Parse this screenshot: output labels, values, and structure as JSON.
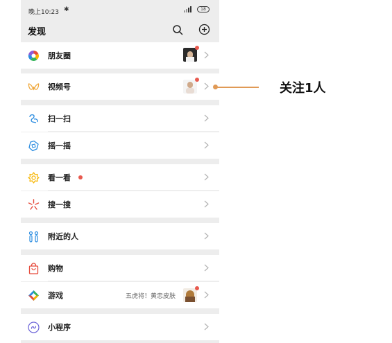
{
  "status_bar": {
    "time": "晚上10:23",
    "bluetooth_glyph": "✱",
    "battery": "18"
  },
  "nav": {
    "title": "发现",
    "search_icon": "search-icon",
    "add_icon": "plus-circle-icon"
  },
  "items": {
    "moments": {
      "label": "朋友圈",
      "icon": "moments-aperture-icon"
    },
    "channels": {
      "label": "视频号",
      "icon": "channels-butterfly-icon"
    },
    "scan": {
      "label": "扫一扫",
      "icon": "scan-icon"
    },
    "shake": {
      "label": "摇一摇",
      "icon": "shake-icon"
    },
    "top_stories": {
      "label": "看一看",
      "icon": "top-stories-icon"
    },
    "search": {
      "label": "搜一搜",
      "icon": "search-sparkle-icon"
    },
    "nearby": {
      "label": "附近的人",
      "icon": "nearby-people-icon"
    },
    "shopping": {
      "label": "购物",
      "icon": "shopping-bag-icon"
    },
    "games": {
      "label": "游戏",
      "icon": "games-diamond-icon",
      "promo": "五虎将！黄忠皮肤"
    },
    "mini_programs": {
      "label": "小程序",
      "icon": "mini-programs-icon"
    }
  },
  "annotation": {
    "text": "关注1人"
  },
  "colors": {
    "accent_red": "#e85a4f",
    "annotation": "#e09a56",
    "background": "#ededed"
  }
}
